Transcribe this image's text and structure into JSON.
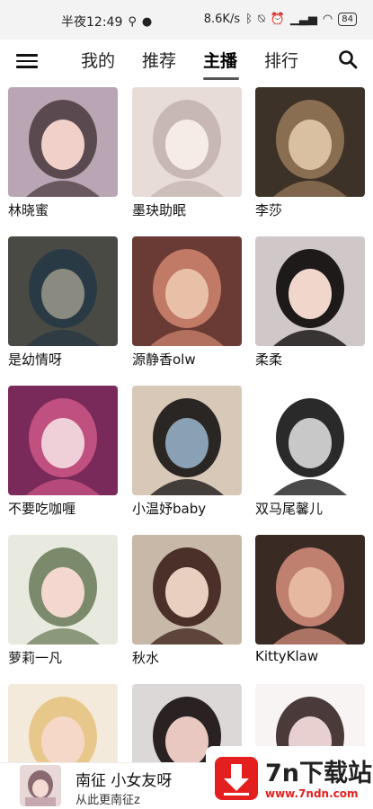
{
  "status_bar": {
    "time": "半夜12:49",
    "speed": "8.6K/s",
    "battery": "84"
  },
  "tabs": [
    {
      "label": "我的",
      "active": false
    },
    {
      "label": "推荐",
      "active": false
    },
    {
      "label": "主播",
      "active": true
    },
    {
      "label": "排行",
      "active": false
    }
  ],
  "anchors": [
    {
      "name": "林晓蜜",
      "palette": [
        "#b9a5b4",
        "#5a4a50",
        "#f0d0c8"
      ]
    },
    {
      "name": "墨玦助眠",
      "palette": [
        "#e8dcd8",
        "#c8b8b4",
        "#f6ece6"
      ]
    },
    {
      "name": "李莎",
      "palette": [
        "#3c3228",
        "#8a6e52",
        "#d9c0a0"
      ]
    },
    {
      "name": "是幼情呀",
      "palette": [
        "#4a4a44",
        "#2a3a44",
        "#8a8a80"
      ]
    },
    {
      "name": "源静香olw",
      "palette": [
        "#6a3a34",
        "#c07a66",
        "#e8c0a8"
      ]
    },
    {
      "name": "柔柔",
      "palette": [
        "#d0c8c8",
        "#1e1a1a",
        "#f1d6cc"
      ]
    },
    {
      "name": "不要吃咖喱",
      "palette": [
        "#7a2a5a",
        "#c05080",
        "#f0d0d8"
      ]
    },
    {
      "name": "小温妤baby",
      "palette": [
        "#d8c8b8",
        "#2a2624",
        "#8aa0b4"
      ]
    },
    {
      "name": "双马尾馨儿",
      "palette": [
        "#ffffff",
        "#2a2a2a",
        "#c8c8c8"
      ]
    },
    {
      "name": "萝莉一凡",
      "palette": [
        "#e8eadf",
        "#7a8a6a",
        "#f4d8d0"
      ]
    },
    {
      "name": "秋水",
      "palette": [
        "#c8b8a8",
        "#4a3028",
        "#e8d0c0"
      ]
    },
    {
      "name": "KittyKlaw",
      "palette": [
        "#3a2a24",
        "#c08070",
        "#e6b8a0"
      ]
    },
    {
      "name": "",
      "palette": [
        "#f4eadc",
        "#e8c88a",
        "#f6d8c8"
      ]
    },
    {
      "name": "",
      "palette": [
        "#dcd8d8",
        "#2a2222",
        "#e8c8c0"
      ]
    },
    {
      "name": "",
      "palette": [
        "#f8f4f4",
        "#4a3a3a",
        "#e8d0d0"
      ]
    }
  ],
  "player": {
    "title": "南征 小女友呀",
    "subtitle": "从此更南征z"
  },
  "watermark": {
    "title": "7n下载站",
    "url": "www.7ndn.com"
  },
  "icons": {
    "menu": "hamburger-menu-icon",
    "search": "search-icon"
  }
}
